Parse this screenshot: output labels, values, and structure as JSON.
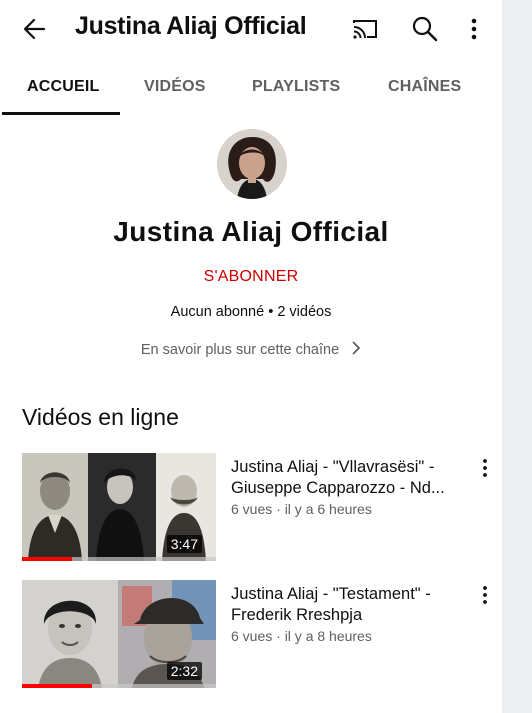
{
  "header": {
    "title": "Justina Aliaj Official",
    "icons": [
      "back-arrow-icon",
      "cast-icon",
      "search-icon",
      "more-vert-icon"
    ]
  },
  "tabs": [
    {
      "label": "ACCUEIL",
      "active": true
    },
    {
      "label": "VIDÉOS",
      "active": false
    },
    {
      "label": "PLAYLISTS",
      "active": false
    },
    {
      "label": "CHAÎNES",
      "active": false
    }
  ],
  "channel": {
    "name": "Justina Aliaj Official",
    "subscribe_label": "S'ABONNER",
    "stats": "Aucun abonné • 2 vidéos",
    "learn_more": "En savoir plus sur cette chaîne"
  },
  "section": {
    "title": "Vidéos en ligne"
  },
  "videos": [
    {
      "title": "Justina Aliaj - \"Vllavrasësi\" - Giuseppe Capparozzo - Nd...",
      "meta": "6 vues · il y a 6 heures",
      "duration": "3:47",
      "watched_fraction": 0.26
    },
    {
      "title": "Justina Aliaj - \"Testament\" - Frederik Rreshpja",
      "meta": "6 vues · il y a 8 heures",
      "duration": "2:32",
      "watched_fraction": 0.36
    }
  ],
  "colors": {
    "subscribe": "#cc0000",
    "progress": "#ff0000",
    "text": "#0f0f0f",
    "secondary": "#606060"
  }
}
